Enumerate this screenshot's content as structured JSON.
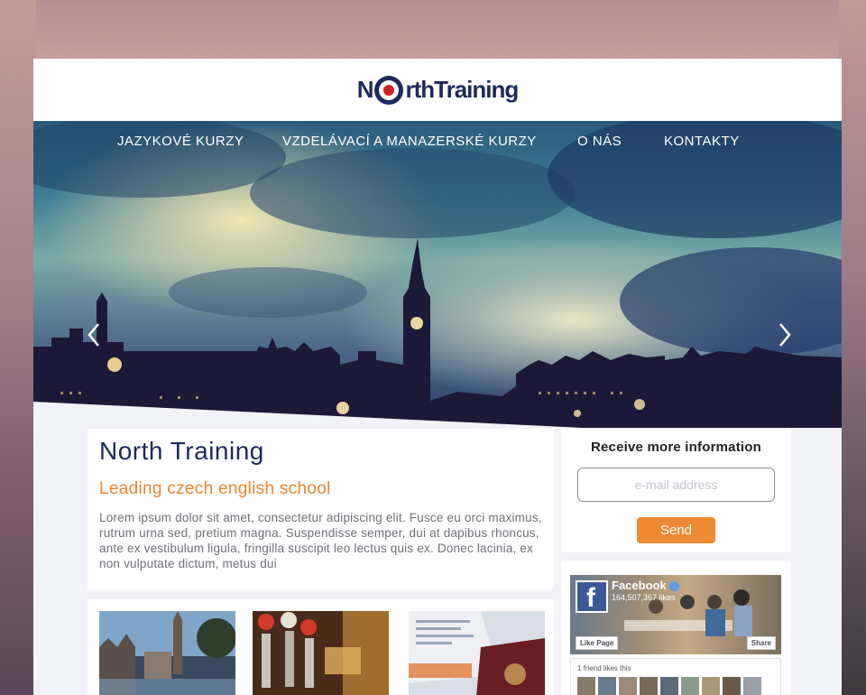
{
  "brand": {
    "logo_part1": "N",
    "logo_part2": "rth",
    "logo_part3": "Training",
    "navy": "#1d2a5c",
    "orange": "#ee8a34",
    "roundel_red": "#d42027"
  },
  "nav": {
    "items": [
      {
        "label": "JAZYKOVÉ KURZY"
      },
      {
        "label": "VZDELÁVACÍ A MANAZERSKÉ KURZY"
      },
      {
        "label": "O NÁS"
      },
      {
        "label": "KONTAKTY"
      }
    ]
  },
  "hero": {
    "prev_icon": "chevron-left-icon",
    "next_icon": "chevron-right-icon"
  },
  "intro": {
    "title": "North Training",
    "subtitle": "Leading czech english school",
    "body": "Lorem ipsum dolor sit amet, consectetur adipiscing elit. Fusce eu orci maximus, rutrum urna sed, pretium magna. Suspendisse semper, dui at dapibus rhoncus, ante ex vestibulum ligula, fringilla suscipit leo lectus quis ex. Donec lacinia, ex non vulputate dictum, metus dui"
  },
  "signup": {
    "title": "Receive more information",
    "email_placeholder": "e-mail address",
    "send_label": "Send"
  },
  "facebook": {
    "page_name": "Facebook",
    "likes": "164,507,367 likes",
    "like_button": "Like Page",
    "share_button": "Share",
    "friends_text": "1 friend likes this"
  }
}
